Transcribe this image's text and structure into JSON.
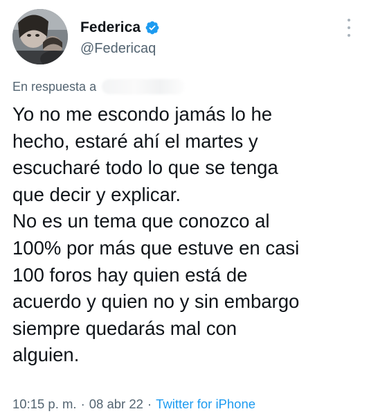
{
  "author": {
    "display_name": "Federica",
    "handle": "@Federicaq",
    "verified": true,
    "avatar_icon": "profile-photo"
  },
  "reply": {
    "label": "En respuesta a"
  },
  "tweet": {
    "lines": [
      "Yo no me escondo jamás lo he",
      "hecho, estaré ahí el martes y",
      "escucharé todo lo que se tenga",
      "que decir y explicar.",
      "No es un tema que conozco al",
      "100% por más que estuve en casi",
      "100 foros hay quien está de",
      "acuerdo y quien no y sin embargo",
      "siempre quedarás mal con",
      "alguien."
    ]
  },
  "meta": {
    "time": "10:15 p. m.",
    "separator": "·",
    "date": "08 abr 22",
    "source": "Twitter for iPhone"
  },
  "colors": {
    "text": "#0f1419",
    "secondary": "#536471",
    "link": "#1d9bf0",
    "verified": "#1d9bf0"
  }
}
